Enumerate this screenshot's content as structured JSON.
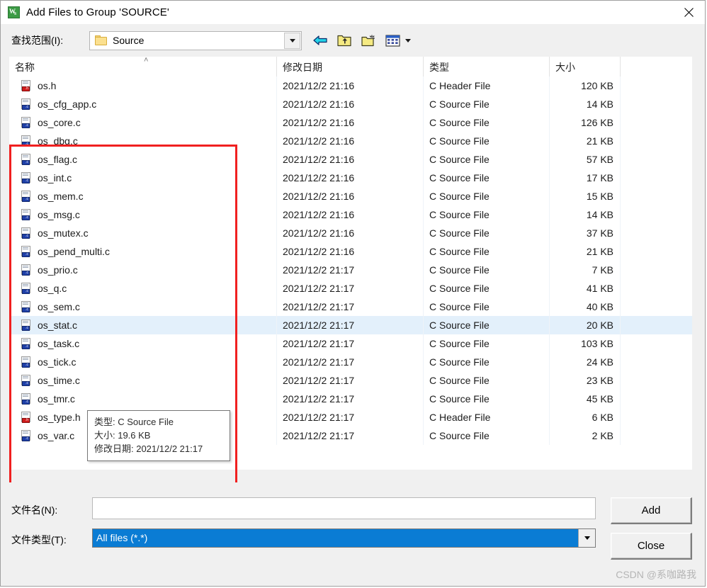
{
  "window": {
    "title": "Add Files to Group 'SOURCE'",
    "app_icon": "uvision-icon",
    "close_label": "✕"
  },
  "lookin": {
    "label": "查找范围(I):",
    "value": "Source",
    "toolbar": [
      {
        "name": "back-arrow-icon",
        "title": "Back"
      },
      {
        "name": "up-folder-icon",
        "title": "Up One Level"
      },
      {
        "name": "new-folder-icon",
        "title": "Create New Folder"
      },
      {
        "name": "views-icon",
        "title": "Views"
      }
    ]
  },
  "columns": {
    "name": "名称",
    "date": "修改日期",
    "type": "类型",
    "size": "大小",
    "sort_indicator": "˄"
  },
  "files": [
    {
      "name": "os.h",
      "icon": "h",
      "date": "2021/12/2 21:16",
      "type": "C Header File",
      "size": "120 KB",
      "hover": false
    },
    {
      "name": "os_cfg_app.c",
      "icon": "c",
      "date": "2021/12/2 21:16",
      "type": "C Source File",
      "size": "14 KB",
      "hover": false
    },
    {
      "name": "os_core.c",
      "icon": "c",
      "date": "2021/12/2 21:16",
      "type": "C Source File",
      "size": "126 KB",
      "hover": false
    },
    {
      "name": "os_dbg.c",
      "icon": "c",
      "date": "2021/12/2 21:16",
      "type": "C Source File",
      "size": "21 KB",
      "hover": false
    },
    {
      "name": "os_flag.c",
      "icon": "c",
      "date": "2021/12/2 21:16",
      "type": "C Source File",
      "size": "57 KB",
      "hover": false
    },
    {
      "name": "os_int.c",
      "icon": "c",
      "date": "2021/12/2 21:16",
      "type": "C Source File",
      "size": "17 KB",
      "hover": false
    },
    {
      "name": "os_mem.c",
      "icon": "c",
      "date": "2021/12/2 21:16",
      "type": "C Source File",
      "size": "15 KB",
      "hover": false
    },
    {
      "name": "os_msg.c",
      "icon": "c",
      "date": "2021/12/2 21:16",
      "type": "C Source File",
      "size": "14 KB",
      "hover": false
    },
    {
      "name": "os_mutex.c",
      "icon": "c",
      "date": "2021/12/2 21:16",
      "type": "C Source File",
      "size": "37 KB",
      "hover": false
    },
    {
      "name": "os_pend_multi.c",
      "icon": "c",
      "date": "2021/12/2 21:16",
      "type": "C Source File",
      "size": "21 KB",
      "hover": false
    },
    {
      "name": "os_prio.c",
      "icon": "c",
      "date": "2021/12/2 21:17",
      "type": "C Source File",
      "size": "7 KB",
      "hover": false
    },
    {
      "name": "os_q.c",
      "icon": "c",
      "date": "2021/12/2 21:17",
      "type": "C Source File",
      "size": "41 KB",
      "hover": false
    },
    {
      "name": "os_sem.c",
      "icon": "c",
      "date": "2021/12/2 21:17",
      "type": "C Source File",
      "size": "40 KB",
      "hover": false
    },
    {
      "name": "os_stat.c",
      "icon": "c",
      "date": "2021/12/2 21:17",
      "type": "C Source File",
      "size": "20 KB",
      "hover": true
    },
    {
      "name": "os_task.c",
      "icon": "c",
      "date": "2021/12/2 21:17",
      "type": "C Source File",
      "size": "103 KB",
      "hover": false
    },
    {
      "name": "os_tick.c",
      "icon": "c",
      "date": "2021/12/2 21:17",
      "type": "C Source File",
      "size": "24 KB",
      "hover": false
    },
    {
      "name": "os_time.c",
      "icon": "c",
      "date": "2021/12/2 21:17",
      "type": "C Source File",
      "size": "23 KB",
      "hover": false
    },
    {
      "name": "os_tmr.c",
      "icon": "c",
      "date": "2021/12/2 21:17",
      "type": "C Source File",
      "size": "45 KB",
      "hover": false
    },
    {
      "name": "os_type.h",
      "icon": "h",
      "date": "2021/12/2 21:17",
      "type": "C Header File",
      "size": "6 KB",
      "hover": false
    },
    {
      "name": "os_var.c",
      "icon": "c",
      "date": "2021/12/2 21:17",
      "type": "C Source File",
      "size": "2 KB",
      "hover": false
    }
  ],
  "tooltip": {
    "type_line": "类型: C Source File",
    "size_line": "大小: 19.6 KB",
    "date_line": "修改日期: 2021/12/2 21:17"
  },
  "form": {
    "filename_label": "文件名(N):",
    "filename_value": "",
    "filetype_label": "文件类型(T):",
    "filetype_value": "All files (*.*)",
    "add_label": "Add",
    "close_label": "Close"
  },
  "watermark": "CSDN @系咖路我",
  "colors": {
    "accent": "#0a7cd4",
    "annotation": "#f02020",
    "hover_row": "#e3f0fb",
    "dialog_bg": "#f0f0f0"
  }
}
